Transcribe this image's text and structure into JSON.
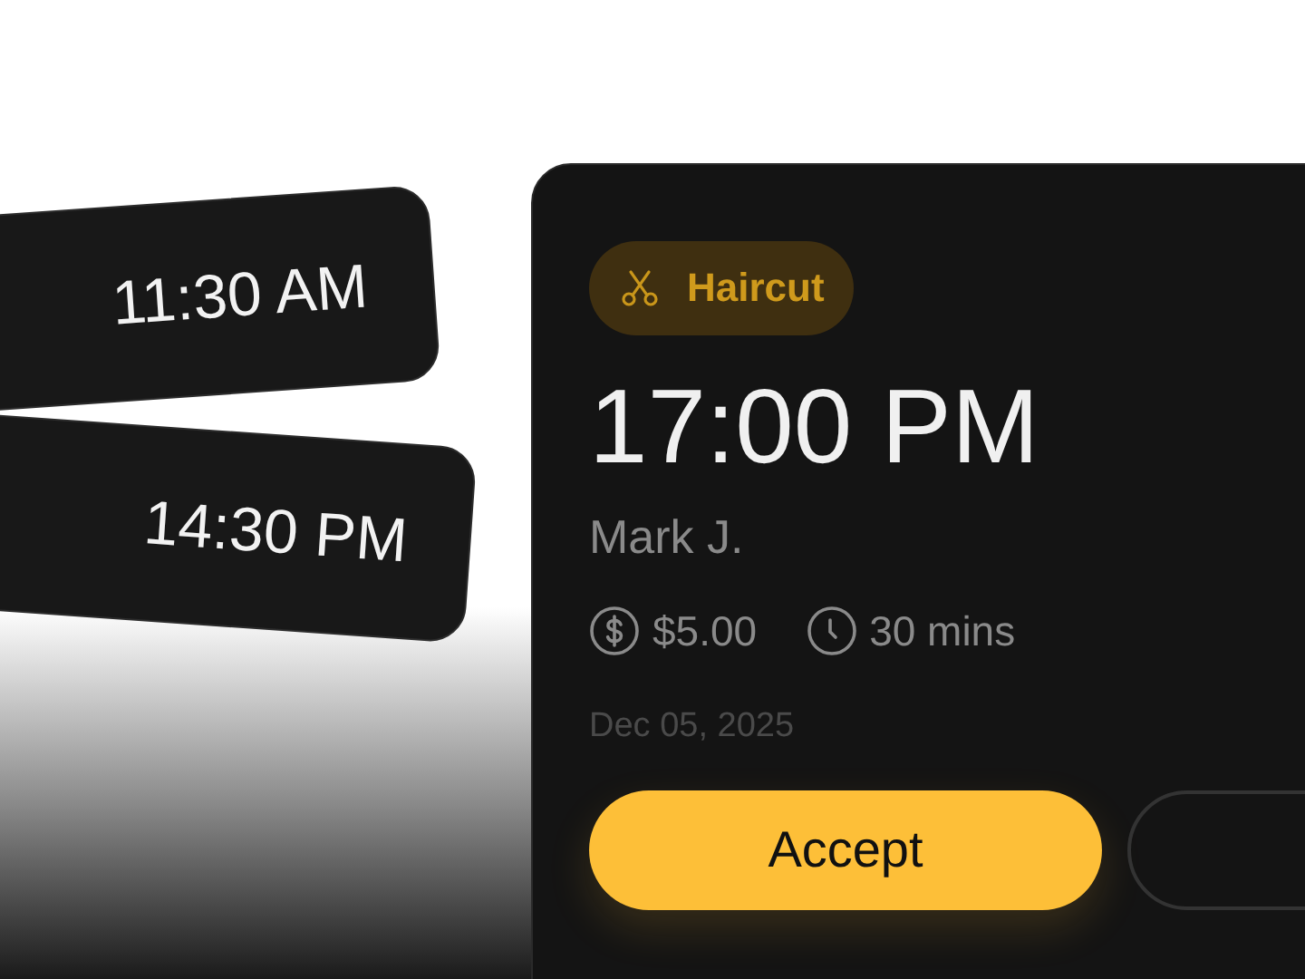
{
  "time_slots": [
    {
      "time": "11:30 AM"
    },
    {
      "time": "14:30 PM"
    }
  ],
  "booking": {
    "service_tag": "Haircut",
    "time": "17:00 PM",
    "client": "Mark J.",
    "price": "$5.00",
    "duration": "30 mins",
    "date": "Dec 05, 2025"
  },
  "buttons": [
    {
      "label": "Accept",
      "kind": "primary"
    },
    {
      "kind": "secondary"
    }
  ]
}
